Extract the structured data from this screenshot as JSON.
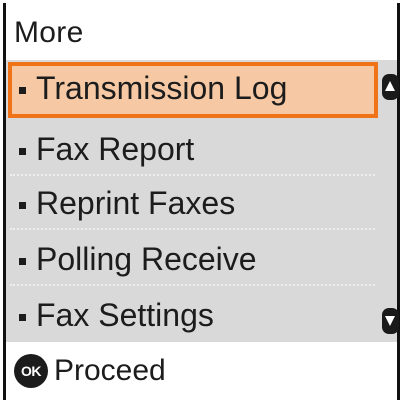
{
  "header": {
    "title": "More"
  },
  "menu": {
    "items": [
      {
        "label": "Transmission Log",
        "selected": true
      },
      {
        "label": "Fax Report",
        "selected": false
      },
      {
        "label": "Reprint Faxes",
        "selected": false
      },
      {
        "label": "Polling Receive",
        "selected": false
      },
      {
        "label": "Fax Settings",
        "selected": false
      }
    ],
    "scroll_up_icon": "up-arrow-icon",
    "scroll_down_icon": "down-arrow-icon"
  },
  "footer": {
    "ok_icon_text": "OK",
    "action_label": "Proceed"
  },
  "colors": {
    "selection_fill": "#f6c9a4",
    "selection_border": "#f07318",
    "list_background": "#d9d9d9"
  }
}
